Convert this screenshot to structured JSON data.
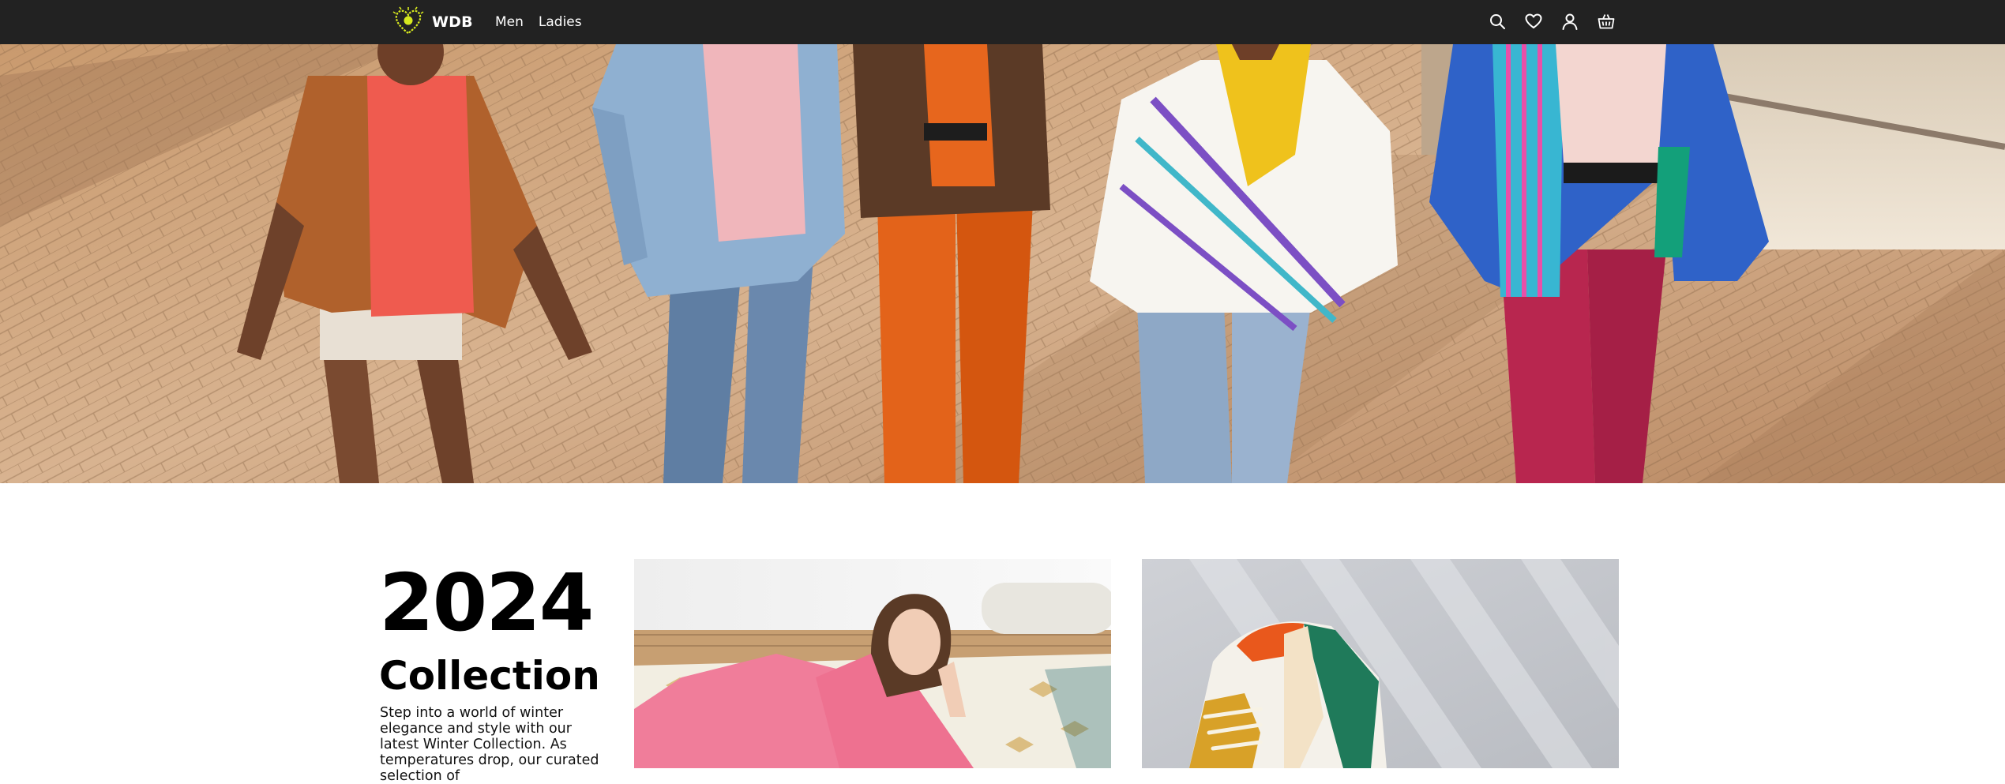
{
  "header": {
    "brand": "WDB",
    "nav": [
      {
        "label": "Men"
      },
      {
        "label": "Ladies"
      }
    ],
    "actions": [
      "search-icon",
      "heart-icon",
      "user-icon",
      "basket-icon"
    ]
  },
  "hero": {
    "image": "group-walking-in-colorful-outfits"
  },
  "collection": {
    "year": "2024",
    "title": "Collection",
    "description": "Step into a world of winter elegance and style with our latest Winter Collection. As temperatures drop, our curated selection of"
  },
  "promos": [
    {
      "image": "woman-in-pink-blouse-on-rug"
    },
    {
      "image": "colorful-sneaker"
    }
  ],
  "colors": {
    "header_bg": "#222222",
    "header_text": "#ffffff",
    "brand_accent": "#d6e81f",
    "page_bg": "#ffffff",
    "text": "#000000"
  }
}
